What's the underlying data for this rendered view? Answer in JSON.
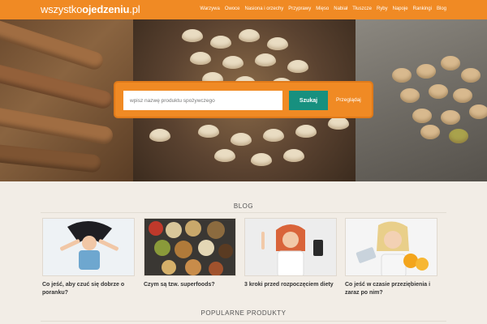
{
  "header": {
    "logo_prefix": "wszystko",
    "logo_bold": "ojedzeniu",
    "logo_suffix": ".pl",
    "nav": [
      "Warzywa",
      "Owoce",
      "Nasiona i orzechy",
      "Przyprawy",
      "Mięso",
      "Nabiał",
      "Tłuszcze",
      "Ryby",
      "Napoje",
      "Rankingi",
      "Blog"
    ]
  },
  "search": {
    "placeholder": "wpisz nazwę produktu spożywczego",
    "button_label": "Szukaj",
    "browse_label": "Przeglądaj"
  },
  "blog": {
    "heading": "BLOG",
    "posts": [
      {
        "title": "Co jeść, aby czuć się dobrze o poranku?"
      },
      {
        "title": "Czym są tzw. superfoods?"
      },
      {
        "title": "3 kroki przed rozpoczęciem diety"
      },
      {
        "title": "Co jeść w czasie przeziębienia i zaraz po nim?"
      }
    ]
  },
  "popular": {
    "heading": "POPULARNE PRODUKTY"
  },
  "colors": {
    "brand_orange": "#f08a24",
    "button_teal": "#17907f",
    "page_bg": "#f2ede6"
  }
}
